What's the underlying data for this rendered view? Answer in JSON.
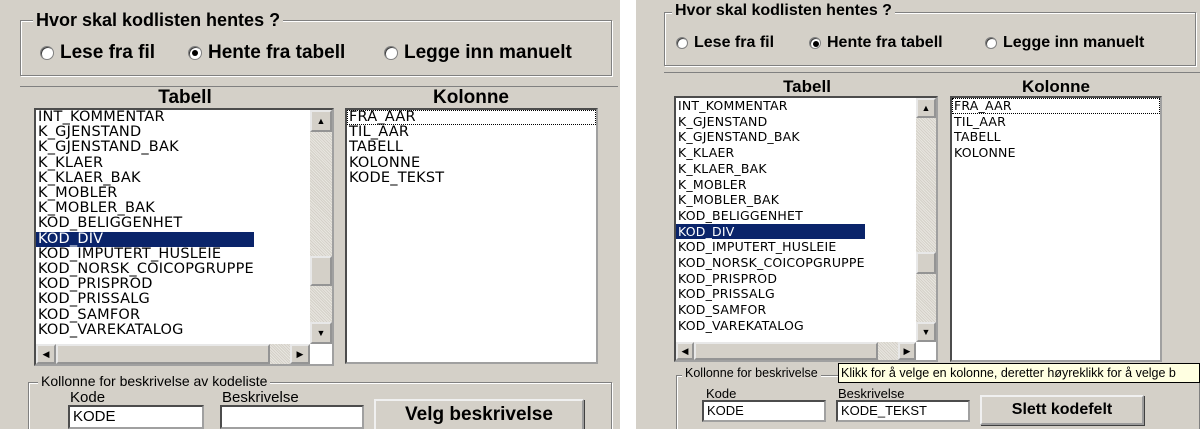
{
  "left": {
    "source_group_title": "Hvor skal kodlisten hentes ?",
    "radios": [
      {
        "label": "Lese fra fil",
        "checked": false
      },
      {
        "label": "Hente fra tabell",
        "checked": true
      },
      {
        "label": "Legge inn manuelt",
        "checked": false
      }
    ],
    "tabell_header": "Tabell",
    "kolonne_header": "Kolonne",
    "tabell_items": [
      "INT_KOMMENTAR",
      "K_GJENSTAND",
      "K_GJENSTAND_BAK",
      "K_KLAER",
      "K_KLAER_BAK",
      "K_MOBLER",
      "K_MOBLER_BAK",
      "KOD_BELIGGENHET",
      "KOD_DIV",
      "KOD_IMPUTERT_HUSLEIE",
      "KOD_NORSK_COICOPGRUPPE",
      "KOD_PRISPROD",
      "KOD_PRISSALG",
      "KOD_SAMFOR",
      "KOD_VAREKATALOG"
    ],
    "tabell_selected": "KOD_DIV",
    "kolonne_items": [
      "FRA_AAR",
      "TIL_AAR",
      "TABELL",
      "KOLONNE",
      "KODE_TEKST"
    ],
    "kolonne_focused": "FRA_AAR",
    "desc_group_title": "Kollonne for beskrivelse av kodeliste",
    "kode_label": "Kode",
    "kode_value": "KODE",
    "beskrivelse_label": "Beskrivelse",
    "beskrivelse_value": "",
    "button_label": "Velg beskrivelse"
  },
  "right": {
    "source_group_title": "Hvor skal kodlisten hentes ?",
    "radios": [
      {
        "label": "Lese fra fil",
        "checked": false
      },
      {
        "label": "Hente fra tabell",
        "checked": true
      },
      {
        "label": "Legge inn manuelt",
        "checked": false
      }
    ],
    "tabell_header": "Tabell",
    "kolonne_header": "Kolonne",
    "tabell_items": [
      "INT_KOMMENTAR",
      "K_GJENSTAND",
      "K_GJENSTAND_BAK",
      "K_KLAER",
      "K_KLAER_BAK",
      "K_MOBLER",
      "K_MOBLER_BAK",
      "KOD_BELIGGENHET",
      "KOD_DIV",
      "KOD_IMPUTERT_HUSLEIE",
      "KOD_NORSK_COICOPGRUPPE",
      "KOD_PRISPROD",
      "KOD_PRISSALG",
      "KOD_SAMFOR",
      "KOD_VAREKATALOG"
    ],
    "tabell_selected": "KOD_DIV",
    "kolonne_items": [
      "FRA_AAR",
      "TIL_AAR",
      "TABELL",
      "KOLONNE"
    ],
    "kolonne_focused": "FRA_AAR",
    "desc_group_title": "Kollonne for beskrivelse",
    "tooltip": "Klikk for å velge en kolonne, deretter høyreklikk for å velge b",
    "kode_label": "Kode",
    "kode_value": "KODE",
    "beskrivelse_label": "Beskrivelse",
    "beskrivelse_value": "KODE_TEKST",
    "button_label": "Slett kodefelt"
  }
}
